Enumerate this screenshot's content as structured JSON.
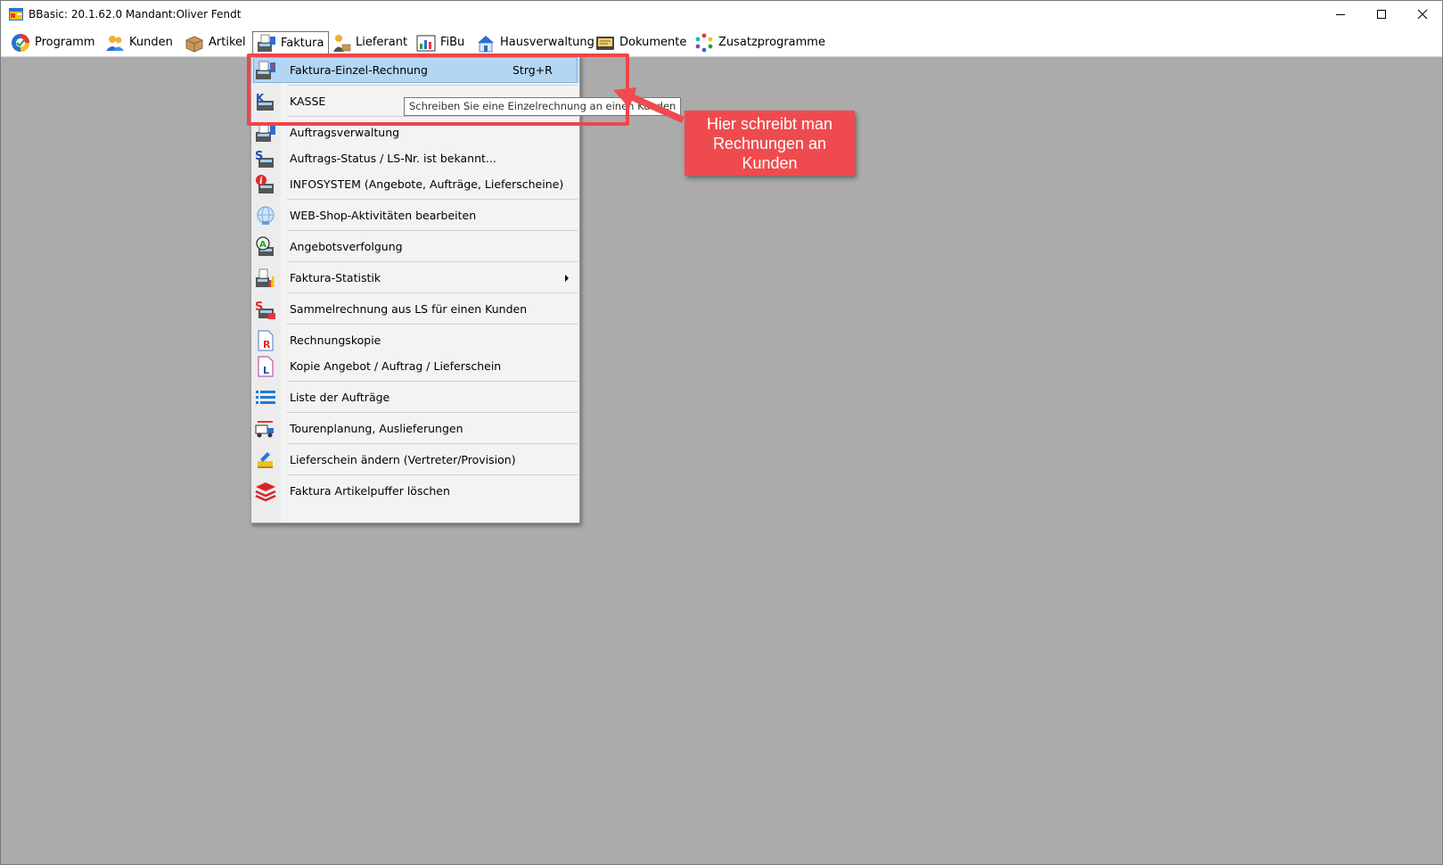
{
  "window": {
    "title": "BBasic: 20.1.62.0 Mandant:Oliver Fendt"
  },
  "menubar": {
    "items": [
      {
        "label": "Programm",
        "icon": "program-icon"
      },
      {
        "label": "Kunden",
        "icon": "customers-icon"
      },
      {
        "label": "Artikel",
        "icon": "articles-icon"
      },
      {
        "label": "Faktura",
        "icon": "billing-icon"
      },
      {
        "label": "Lieferant",
        "icon": "supplier-icon"
      },
      {
        "label": "FiBu",
        "icon": "accounting-icon"
      },
      {
        "label": "Hausverwaltung",
        "icon": "property-management-icon"
      },
      {
        "label": "Dokumente",
        "icon": "documents-icon"
      },
      {
        "label": "Zusatzprogramme",
        "icon": "addons-icon"
      }
    ],
    "active": "Faktura"
  },
  "dropdown": {
    "items": [
      {
        "label": "Faktura-Einzel-Rechnung",
        "shortcut": "Strg+R",
        "icon": "single-invoice-icon"
      },
      {
        "label": "KASSE",
        "icon": "cash-register-icon"
      },
      {
        "label": "Auftragsverwaltung",
        "icon": "order-management-icon"
      },
      {
        "label": "Auftrags-Status / LS-Nr. ist bekannt...",
        "icon": "order-status-icon"
      },
      {
        "label": "INFOSYSTEM (Angebote, Aufträge, Lieferscheine)",
        "icon": "infosystem-icon"
      },
      {
        "label": "WEB-Shop-Aktivitäten bearbeiten",
        "icon": "webshop-icon"
      },
      {
        "label": "Angebotsverfolgung",
        "icon": "quote-tracking-icon"
      },
      {
        "label": "Faktura-Statistik",
        "icon": "statistics-icon"
      },
      {
        "label": "Sammelrechnung aus LS für einen Kunden",
        "icon": "collective-invoice-icon"
      },
      {
        "label": "Rechnungskopie",
        "icon": "invoice-copy-icon"
      },
      {
        "label": "Kopie Angebot / Auftrag / Lieferschein",
        "icon": "document-copy-icon"
      },
      {
        "label": "Liste der Aufträge",
        "icon": "list-icon"
      },
      {
        "label": "Tourenplanung, Auslieferungen",
        "icon": "tour-planning-icon"
      },
      {
        "label": "Lieferschein ändern (Vertreter/Provision)",
        "icon": "edit-delivery-icon"
      },
      {
        "label": "Faktura Artikelpuffer löschen",
        "icon": "layers-delete-icon"
      }
    ]
  },
  "tooltip": {
    "text": "Schreiben Sie eine Einzelrechnung an einen Kunden"
  },
  "annotation": {
    "text": "Hier schreibt man Rechnungen an Kunden",
    "color": "#ef4b4f"
  }
}
